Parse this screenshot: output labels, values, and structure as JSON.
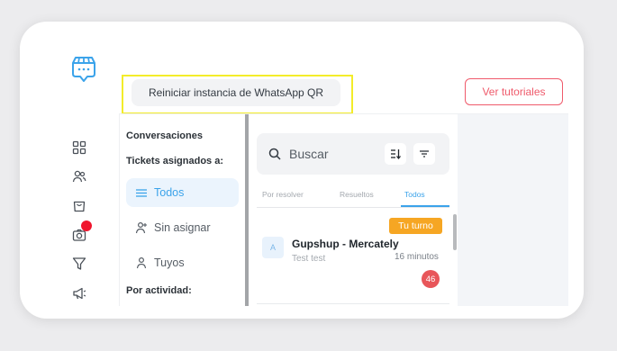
{
  "header": {
    "reset_button": "Reiniciar instancia de WhatsApp QR",
    "tutorial_button": "Ver tutoriales"
  },
  "nav": {
    "section_conversations": "Conversaciones",
    "section_tickets": "Tickets asignados a:",
    "items": [
      {
        "label": "Todos",
        "icon": "list-icon",
        "active": true
      },
      {
        "label": "Sin asignar",
        "icon": "user-plus-icon",
        "active": false
      },
      {
        "label": "Tuyos",
        "icon": "user-icon",
        "active": false
      }
    ],
    "section_activity": "Por actividad:"
  },
  "rail": {
    "icons": [
      "dashboard-icon",
      "users-icon",
      "shopping-bag-icon",
      "camera-icon",
      "filter-icon",
      "megaphone-icon"
    ],
    "notification_color": "#f0152d"
  },
  "search": {
    "placeholder": "Buscar"
  },
  "tabs": [
    {
      "label": "Por resolver",
      "active": false
    },
    {
      "label": "Resueltos",
      "active": false
    },
    {
      "label": "Todos",
      "active": true
    }
  ],
  "conversation": {
    "badge": "Tu turno",
    "avatar": "A",
    "name": "Gupshup - Mercately",
    "last_message": "Test test",
    "time": "16 minutos",
    "unread": "46"
  },
  "colors": {
    "accent": "#3ba3ea",
    "tutorial": "#ef5a6b",
    "turn_badge": "#f6a623",
    "unread_badge": "#e8565a",
    "highlight": "#f3ec2a"
  }
}
